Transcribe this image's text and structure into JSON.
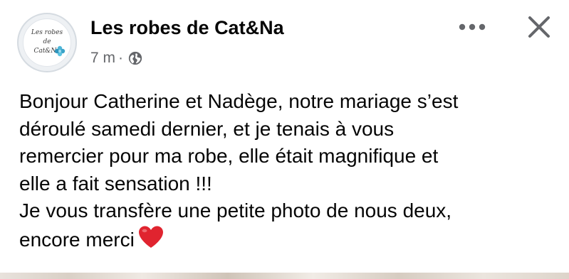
{
  "page": {
    "name": "Les robes de Cat&Na",
    "logo": {
      "line1": "Les robes",
      "line2": "de",
      "line3": "Cat&Na"
    },
    "timestamp": "7 m",
    "separator": "·",
    "audience_icon": "globe-icon"
  },
  "actions": {
    "more_icon": "more-horizontal-icon",
    "close_icon": "close-icon"
  },
  "post": {
    "text": "Bonjour Catherine et Nadège, notre mariage s’est\ndéroulé samedi dernier, et je tenais à vous\nremercier pour ma robe, elle était magnifique et\nelle a fait sensation !!!\nJe vous transfère une petite photo de nous deux,\nencore merci",
    "emoji": "heart-icon",
    "heart_color": "#e0242f"
  },
  "colors": {
    "text": "#050505",
    "secondary": "#65676b"
  }
}
